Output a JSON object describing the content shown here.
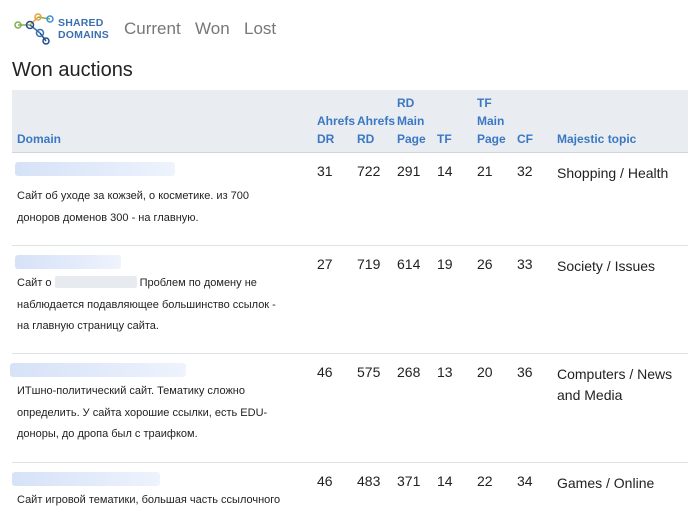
{
  "brand": {
    "line1": "SHARED",
    "line2": "DOMAINS"
  },
  "nav": {
    "items": [
      "Current",
      "Won",
      "Lost"
    ]
  },
  "page_title": "Won auctions",
  "table": {
    "headers": {
      "domain": "Domain",
      "ahrefs_dr": [
        "Ahrefs",
        "DR"
      ],
      "ahrefs_rd": [
        "Ahrefs",
        "RD"
      ],
      "rd_main": [
        "RD",
        "Main",
        "Page"
      ],
      "tf": "TF",
      "tf_main": [
        "TF",
        "Main",
        "Page"
      ],
      "cf": "CF",
      "topic": "Majestic topic"
    },
    "rows": [
      {
        "dr": "31",
        "rd": "722",
        "rd_main": "291",
        "tf": "14",
        "tf_main": "21",
        "cf": "32",
        "topic": "Shopping / Health",
        "desc_lines": [
          "Сайт об уходе за кожзей, о косметике. из 700",
          "доноров доменов 300 - на главную."
        ]
      },
      {
        "dr": "27",
        "rd": "719",
        "rd_main": "614",
        "tf": "19",
        "tf_main": "26",
        "cf": "33",
        "topic": "Society / Issues",
        "desc_prefix": "Сайт о",
        "desc_lines": [
          "Проблем по домену не",
          "наблюдается подавляющее большинство ссылок -",
          "на главную страницу сайта."
        ]
      },
      {
        "dr": "46",
        "rd": "575",
        "rd_main": "268",
        "tf": "13",
        "tf_main": "20",
        "cf": "36",
        "topic": "Computers / News and Media",
        "desc_lines": [
          "ИТшно-политический сайт. Тематику сложно",
          "определить. У сайта хорошие ссылки, есть EDU-",
          "доноры, до дропа был с траифком."
        ]
      },
      {
        "dr": "46",
        "rd": "483",
        "rd_main": "371",
        "tf": "14",
        "tf_main": "22",
        "cf": "34",
        "topic": "Games / Online",
        "desc_lines": [
          "Сайт игровой тематики, большая часть ссылочного"
        ]
      }
    ]
  }
}
